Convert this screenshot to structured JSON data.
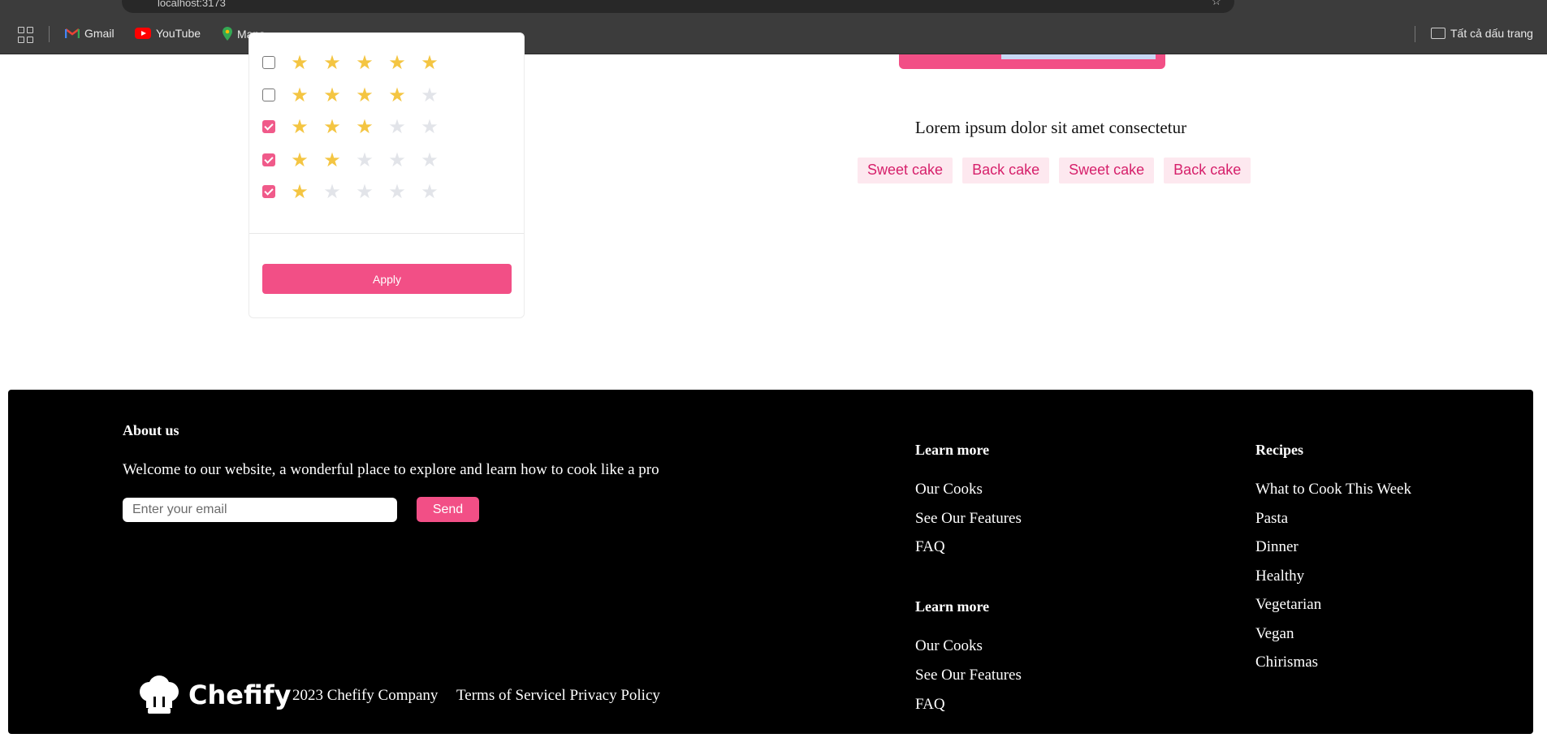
{
  "browser": {
    "url": "localhost:3173",
    "bookmarks": [
      "Gmail",
      "YouTube",
      "Maps"
    ],
    "all_bookmarks_label": "Tất cả dấu trang"
  },
  "filter": {
    "ratings": [
      {
        "stars": 5,
        "checked": false
      },
      {
        "stars": 4,
        "checked": false
      },
      {
        "stars": 3,
        "checked": true
      },
      {
        "stars": 2,
        "checked": true
      },
      {
        "stars": 1,
        "checked": true
      }
    ],
    "apply_label": "Apply"
  },
  "content": {
    "lorem": "Lorem ipsum dolor sit amet consectetur",
    "tags": [
      "Sweet cake",
      "Back cake",
      "Sweet cake",
      "Back cake"
    ]
  },
  "footer": {
    "about_title": "About us",
    "about_text": "Welcome to our website, a wonderful place to explore and learn how to cook like a pro",
    "email_placeholder": "Enter your email",
    "send_label": "Send",
    "learn_more_1": {
      "title": "Learn more",
      "links": [
        "Our Cooks",
        "See Our Features",
        "FAQ"
      ]
    },
    "learn_more_2": {
      "title": "Learn more",
      "links": [
        "Our Cooks",
        "See Our Features",
        "FAQ"
      ]
    },
    "recipes": {
      "title": "Recipes",
      "links": [
        "What to Cook This Week",
        "Pasta",
        "Dinner",
        "Healthy",
        "Vegetarian",
        "Vegan",
        "Chirismas"
      ]
    },
    "logo_name": "Chefify",
    "copyright": "2023 Chefify Company",
    "terms": "Terms of Servicel Privacy Policy"
  },
  "colors": {
    "accent": "#f24f86",
    "star_on": "#f4c542",
    "star_off": "#e2e4e9",
    "tag_bg": "#fde8ef",
    "tag_text": "#d6206b"
  }
}
